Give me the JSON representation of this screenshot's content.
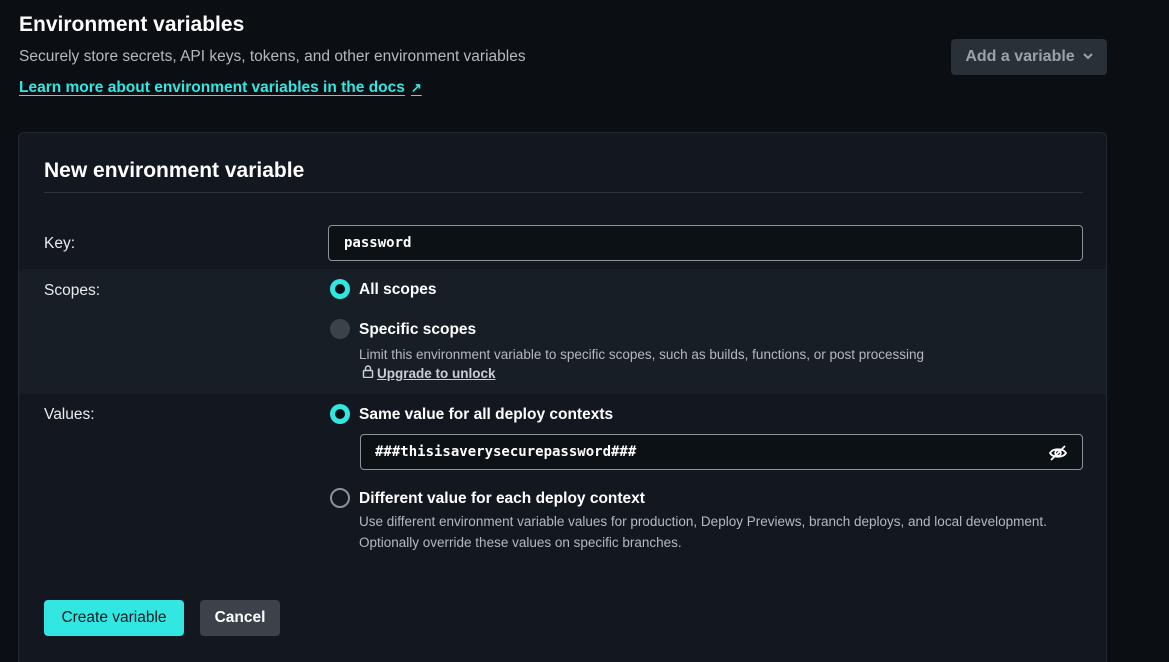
{
  "header": {
    "title": "Environment variables",
    "subtitle": "Securely store secrets, API keys, tokens, and other environment variables",
    "docs_link": "Learn more about environment variables in the docs",
    "docs_link_icon": "external-link-arrow",
    "add_button": "Add a variable",
    "add_button_icon": "chevron-down"
  },
  "form": {
    "title": "New environment variable",
    "key": {
      "label": "Key:",
      "value": "password"
    },
    "scopes": {
      "label": "Scopes:",
      "options": [
        {
          "label": "All scopes",
          "selected": true
        },
        {
          "label": "Specific scopes",
          "selected": false,
          "disabled": true,
          "description": "Limit this environment variable to specific scopes, such as builds, functions, or post processing",
          "upgrade_link": "Upgrade to unlock",
          "upgrade_icon": "lock-icon"
        }
      ]
    },
    "values": {
      "label": "Values:",
      "options": [
        {
          "label": "Same value for all deploy contexts",
          "selected": true
        },
        {
          "label": "Different value for each deploy context",
          "selected": false,
          "description_line1": "Use different environment variable values for production, Deploy Previews, branch deploys, and local development.",
          "description_line2": "Optionally override these values on specific branches."
        }
      ],
      "value": "###thisisaverysecurepassword###",
      "visibility_icon": "eye-off-icon"
    },
    "create_button": "Create variable",
    "cancel_button": "Cancel"
  },
  "colors": {
    "background": "#0b0f14",
    "card": "#131820",
    "accent": "#32e6e2",
    "text": "#e9ebed",
    "muted": "#b4b9be"
  }
}
